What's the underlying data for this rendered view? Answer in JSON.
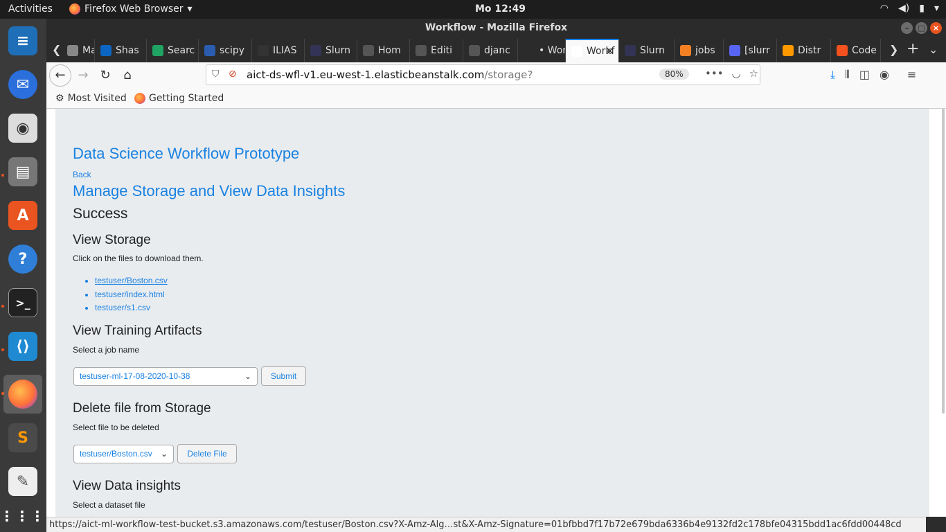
{
  "topbar": {
    "activities": "Activities",
    "app_name": "Firefox Web Browser",
    "clock": "Mo 12:49"
  },
  "window": {
    "title": "Workflow - Mozilla Firefox"
  },
  "tabs": [
    {
      "label": "Mach",
      "color": "#888"
    },
    {
      "label": "Shas",
      "color": "#0a66c2"
    },
    {
      "label": "Searc",
      "color": "#1fa463"
    },
    {
      "label": "scipy",
      "color": "#2a5db0"
    },
    {
      "label": "ILIAS",
      "color": "#333"
    },
    {
      "label": "Slurn",
      "color": "#335"
    },
    {
      "label": "Hom",
      "color": "#555"
    },
    {
      "label": "Editi",
      "color": "#555"
    },
    {
      "label": "djanc",
      "color": "#555"
    },
    {
      "label": "• Work",
      "color": "#2b2b2b"
    },
    {
      "label": "Workf",
      "color": "#fff",
      "active": true
    },
    {
      "label": "Slurn",
      "color": "#335"
    },
    {
      "label": "jobs",
      "color": "#f48024"
    },
    {
      "label": "[slurr",
      "color": "#5865f2"
    },
    {
      "label": "Distr",
      "color": "#ff9900"
    },
    {
      "label": "Code",
      "color": "#f4511e"
    }
  ],
  "urlbar": {
    "host": "aict-ds-wfl-v1.eu-west-1.elasticbeanstalk.com",
    "path": "/storage?",
    "zoom": "80%"
  },
  "bookmarks": {
    "most_visited": "Most Visited",
    "getting_started": "Getting Started"
  },
  "page": {
    "title": "Data Science Workflow Prototype",
    "back": "Back",
    "subtitle": "Manage Storage and View Data Insights",
    "status": "Success",
    "view_storage": {
      "heading": "View Storage",
      "hint": "Click on the files to download them.",
      "files": [
        "testuser/Boston.csv",
        "testuser/index.html",
        "testuser/s1.csv"
      ]
    },
    "training": {
      "heading": "View Training Artifacts",
      "hint": "Select a job name",
      "selected": "testuser-ml-17-08-2020-10-38",
      "submit": "Submit"
    },
    "delete": {
      "heading": "Delete file from Storage",
      "hint": "Select file to be deleted",
      "selected": "testuser/Boston.csv",
      "button": "Delete File"
    },
    "insights": {
      "heading": "View Data insights",
      "hint": "Select a dataset file"
    }
  },
  "statusbar": {
    "link": "https://aict-ml-workflow-test-bucket.s3.amazonaws.com/testuser/Boston.csv?X-Amz-Alg…st&X-Amz-Signature=01bfbbd7f17b72e679bda6336b4e9132fd2c178bfe04315bdd1ac6fdd00448cd"
  }
}
